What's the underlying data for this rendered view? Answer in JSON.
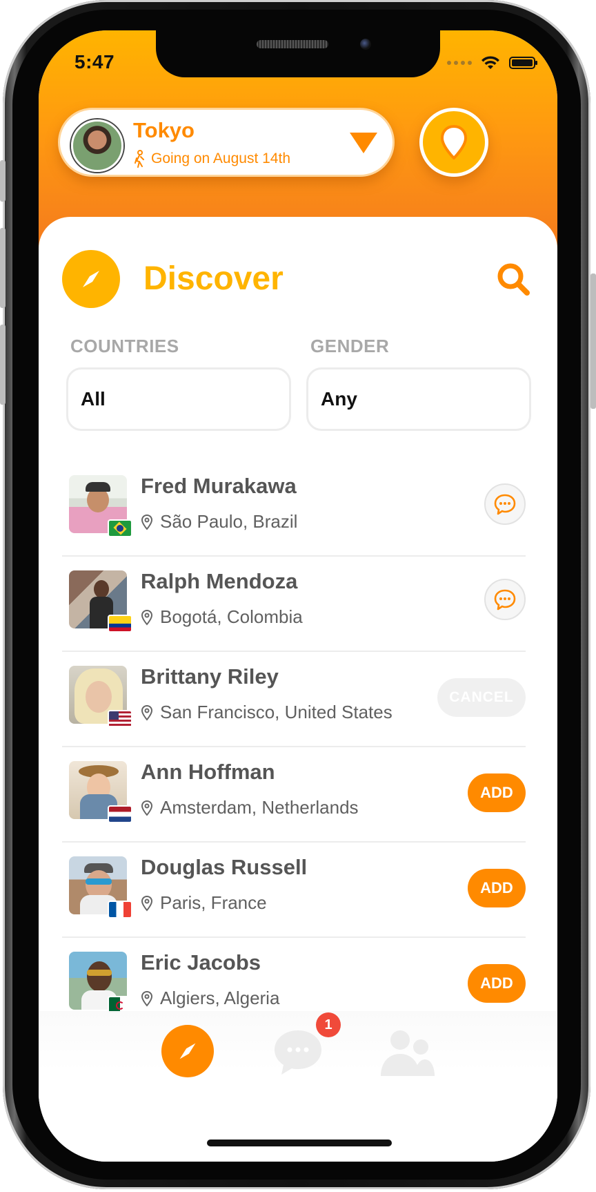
{
  "status_bar": {
    "time": "5:47"
  },
  "trip": {
    "city": "Tokyo",
    "subtitle": "Going on August 14th"
  },
  "discover": {
    "title": "Discover"
  },
  "filters": {
    "countries_label": "COUNTRIES",
    "countries_value": "All",
    "gender_label": "GENDER",
    "gender_value": "Any"
  },
  "people": [
    {
      "name": "Fred Murakawa",
      "location": "São Paulo, Brazil",
      "action": "chat",
      "flag": "brazil-flag"
    },
    {
      "name": "Ralph Mendoza",
      "location": "Bogotá, Colombia",
      "action": "chat",
      "flag": "colombia-flag"
    },
    {
      "name": "Brittany Riley",
      "location": "San Francisco, United States",
      "action": "cancel",
      "action_label": "CANCEL",
      "flag": "usa-flag"
    },
    {
      "name": "Ann Hoffman",
      "location": "Amsterdam, Netherlands",
      "action": "add",
      "action_label": "ADD",
      "flag": "netherlands-flag"
    },
    {
      "name": "Douglas Russell",
      "location": "Paris, France",
      "action": "add",
      "action_label": "ADD",
      "flag": "france-flag"
    },
    {
      "name": "Eric Jacobs",
      "location": "Algiers, Algeria",
      "action": "add",
      "action_label": "ADD",
      "flag": "algeria-flag"
    }
  ],
  "bottom_nav": {
    "chat_badge": "1"
  },
  "colors": {
    "accent": "#ff8a00",
    "accent_yellow": "#ffb400",
    "badge": "#f04a3a"
  }
}
